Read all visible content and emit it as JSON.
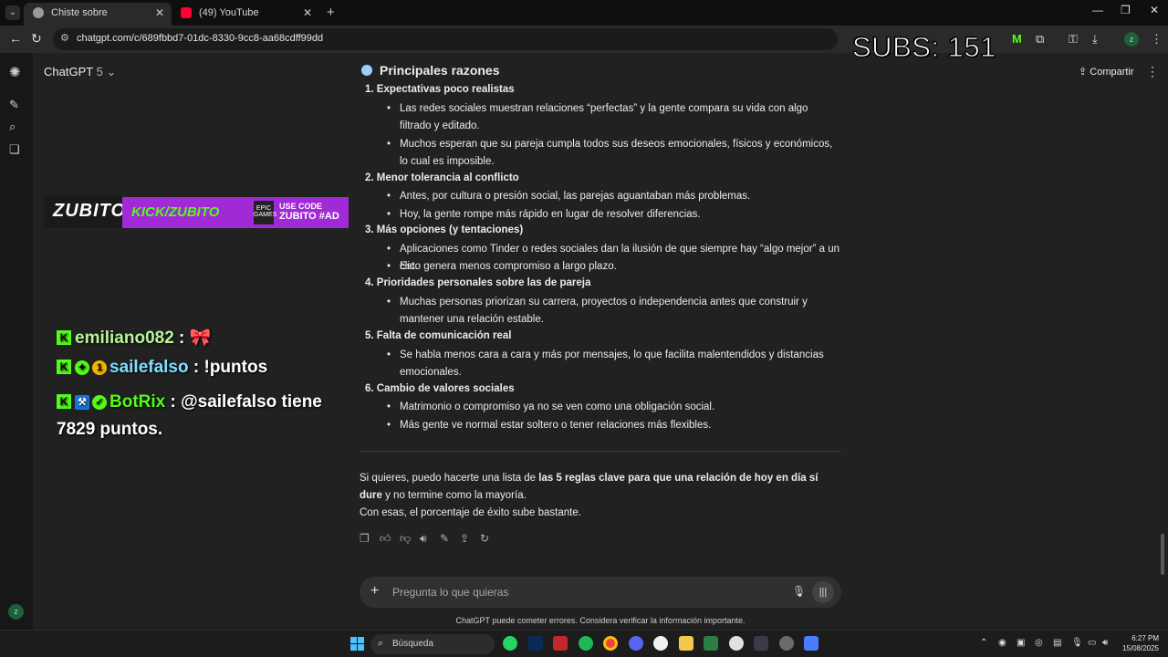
{
  "browser": {
    "tabs": [
      {
        "title": "Chiste sobre estereotipos",
        "active": true
      },
      {
        "title": "(49) YouTube",
        "active": false
      }
    ],
    "url": "chatgpt.com/c/689fbbd7-01dc-8330-9cc8-aa68cdff99dd"
  },
  "overlay": {
    "subs": "SUBS: 151",
    "banner_left": "ZUBITO",
    "banner_kick": "KICK/ZUBITO",
    "banner_epic": "EPIC GAMES",
    "banner_code_label": "USE CODE",
    "banner_code": "ZUBITO #AD"
  },
  "chat_messages": [
    {
      "user": "emiliano082",
      "sep": " :",
      "text": " 🎀"
    },
    {
      "user": "sailefalso",
      "sep": " :",
      "text": " !puntos"
    },
    {
      "user": "BotRix",
      "sep": " :",
      "text": " @sailefalso tiene",
      "text2": "7829 puntos."
    }
  ],
  "header": {
    "model_name": "ChatGPT",
    "model_version": "5",
    "share_label": "Compartir"
  },
  "answer": {
    "heading": "Principales razones",
    "reasons": [
      {
        "title": "1.  Expectativas poco realistas",
        "bullets": [
          "Las redes sociales muestran relaciones “perfectas” y la gente compara su vida con algo filtrado y editado.",
          "Muchos esperan que su pareja cumpla todos sus deseos emocionales, físicos y económicos, lo cual es imposible."
        ]
      },
      {
        "title": "2.  Menor tolerancia al conflicto",
        "bullets": [
          "Antes, por cultura o presión social, las parejas aguantaban más problemas.",
          "Hoy, la gente rompe más rápido en lugar de resolver diferencias."
        ]
      },
      {
        "title": "3.  Más opciones (y tentaciones)",
        "bullets": [
          "Aplicaciones como Tinder o redes sociales dan la ilusión de que siempre hay “algo mejor” a un clic.",
          "Esto genera menos compromiso a largo plazo."
        ]
      },
      {
        "title": "4.  Prioridades personales sobre las de pareja",
        "bullets": [
          "Muchas personas priorizan su carrera, proyectos o independencia antes que construir y mantener una relación estable."
        ]
      },
      {
        "title": "5.  Falta de comunicación real",
        "bullets": [
          "Se habla menos cara a cara y más por mensajes, lo que facilita malentendidos y distancias emocionales."
        ]
      },
      {
        "title": "6.  Cambio de valores sociales",
        "bullets": [
          "Matrimonio o compromiso ya no se ven como una obligación social.",
          "Más gente ve normal estar soltero o tener relaciones más flexibles."
        ]
      }
    ],
    "closing_pre": "Si quieres, puedo hacerte una lista de ",
    "closing_bold": "las 5 reglas clave para que una relación de hoy en día sí dure",
    "closing_post": " y no termine como la mayoría.",
    "closing_2": "Con esas, el porcentaje de éxito sube bastante."
  },
  "composer": {
    "placeholder": "Pregunta lo que quieras"
  },
  "disclaimer": "ChatGPT puede cometer errores. Considera verificar la información importante.",
  "taskbar": {
    "search_label": "Búsqueda",
    "time": "6:27 PM",
    "date": "15/08/2025"
  },
  "colors": {
    "background": "#212121",
    "kick_green": "#53fc18",
    "banner_purple": "#a02bd6"
  }
}
